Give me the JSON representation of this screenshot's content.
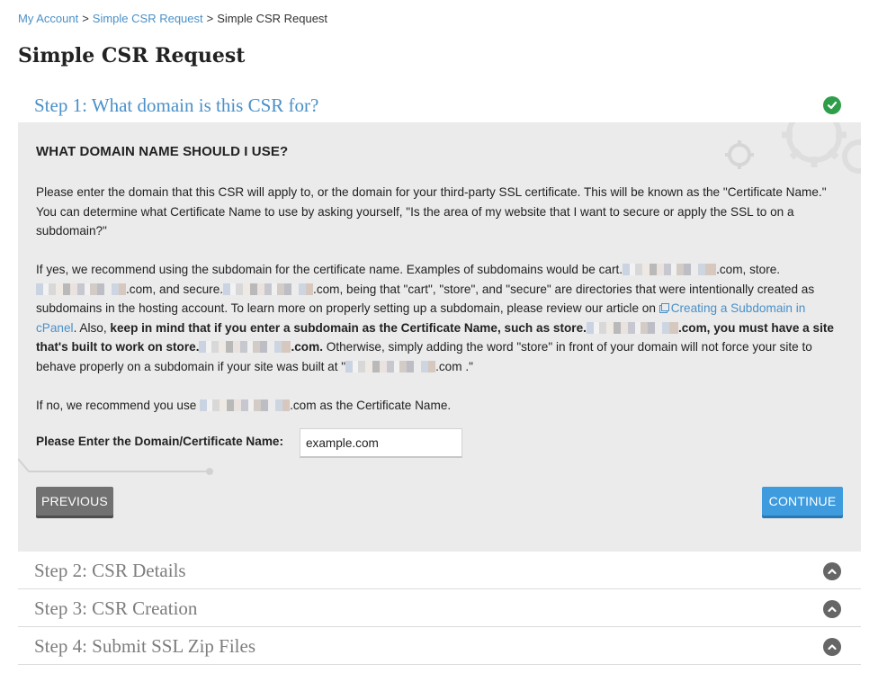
{
  "breadcrumb": {
    "items": [
      "My Account",
      "Simple CSR Request"
    ],
    "current": "Simple CSR Request",
    "separator": ">"
  },
  "page_title": "Simple CSR Request",
  "steps": [
    {
      "label": "Step 1: What domain is this CSR for?",
      "state": "complete",
      "icon": "check-circle-icon"
    },
    {
      "label": "Step 2: CSR Details",
      "state": "collapsed",
      "icon": "chevron-up-circle-icon"
    },
    {
      "label": "Step 3: CSR Creation",
      "state": "collapsed",
      "icon": "chevron-up-circle-icon"
    },
    {
      "label": "Step 4: Submit SSL Zip Files",
      "state": "collapsed",
      "icon": "chevron-up-circle-icon"
    }
  ],
  "panel": {
    "heading": "WHAT DOMAIN NAME SHOULD I USE?",
    "para1": "Please enter the domain that this CSR will apply to, or the domain for your third-party SSL certificate. This will be known as the \"Certificate Name.\" You can determine what Certificate Name to use by asking yourself, \"Is the area of my website that I want to secure or apply the SSL to on a subdomain?\"",
    "para2": {
      "t1": "If yes, we recommend using the subdomain for the certificate name. Examples of subdomains would be cart.",
      "t2": ".com, store.",
      "t3": ".com, and secure.",
      "t4": ".com, being that \"cart\", \"store\", and \"secure\" are directories that were intentionally created as subdomains in the hosting account. To learn more on properly setting up a subdomain, please review our article on ",
      "link": "Creating a Subdomain in cPanel",
      "t5": ". Also, ",
      "b1": "keep in mind that if you enter a subdomain as the Certificate Name, such as store.",
      "b2": ".com, you must have a site that's built to work on store.",
      "b3": ".com.",
      "t6": " Otherwise, simply adding the word \"store\" in front of your domain will not force your site to behave properly on a subdomain if your site was built at \"",
      "t7": ".com .\""
    },
    "para3": {
      "t1": "If no, we recommend you use ",
      "t2": ".com as the Certificate Name."
    },
    "field_label": "Please Enter the Domain/Certificate Name:",
    "field_value": "example.com",
    "previous_label": "PREVIOUS",
    "continue_label": "CONTINUE"
  },
  "colors": {
    "link": "#4a90c8",
    "complete": "#2e9e4a",
    "panel_bg": "#ebebeb",
    "continue": "#3d9bde",
    "previous": "#717171"
  }
}
